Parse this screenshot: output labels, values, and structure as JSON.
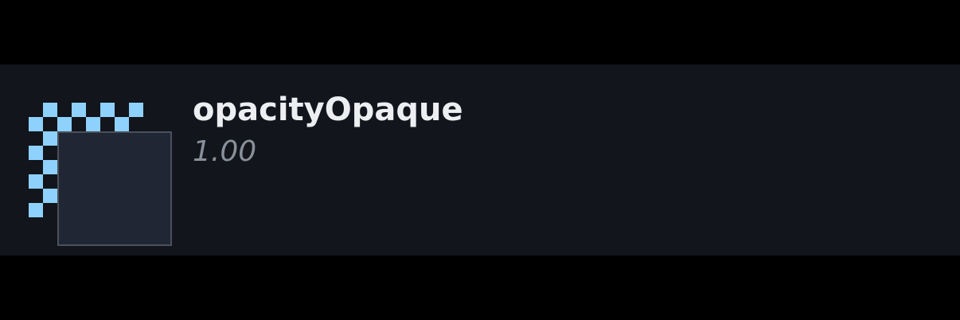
{
  "token": {
    "name": "opacityOpaque",
    "value": "1.00",
    "opacity_level": 1.0
  },
  "colors": {
    "page_background": "#000000",
    "card_background": "#12151c",
    "checker_color": "#8ed1fc",
    "swatch_fill": "#202633",
    "swatch_border": "#4a505c",
    "name_text": "#eceef2",
    "value_text": "#8a909a"
  }
}
